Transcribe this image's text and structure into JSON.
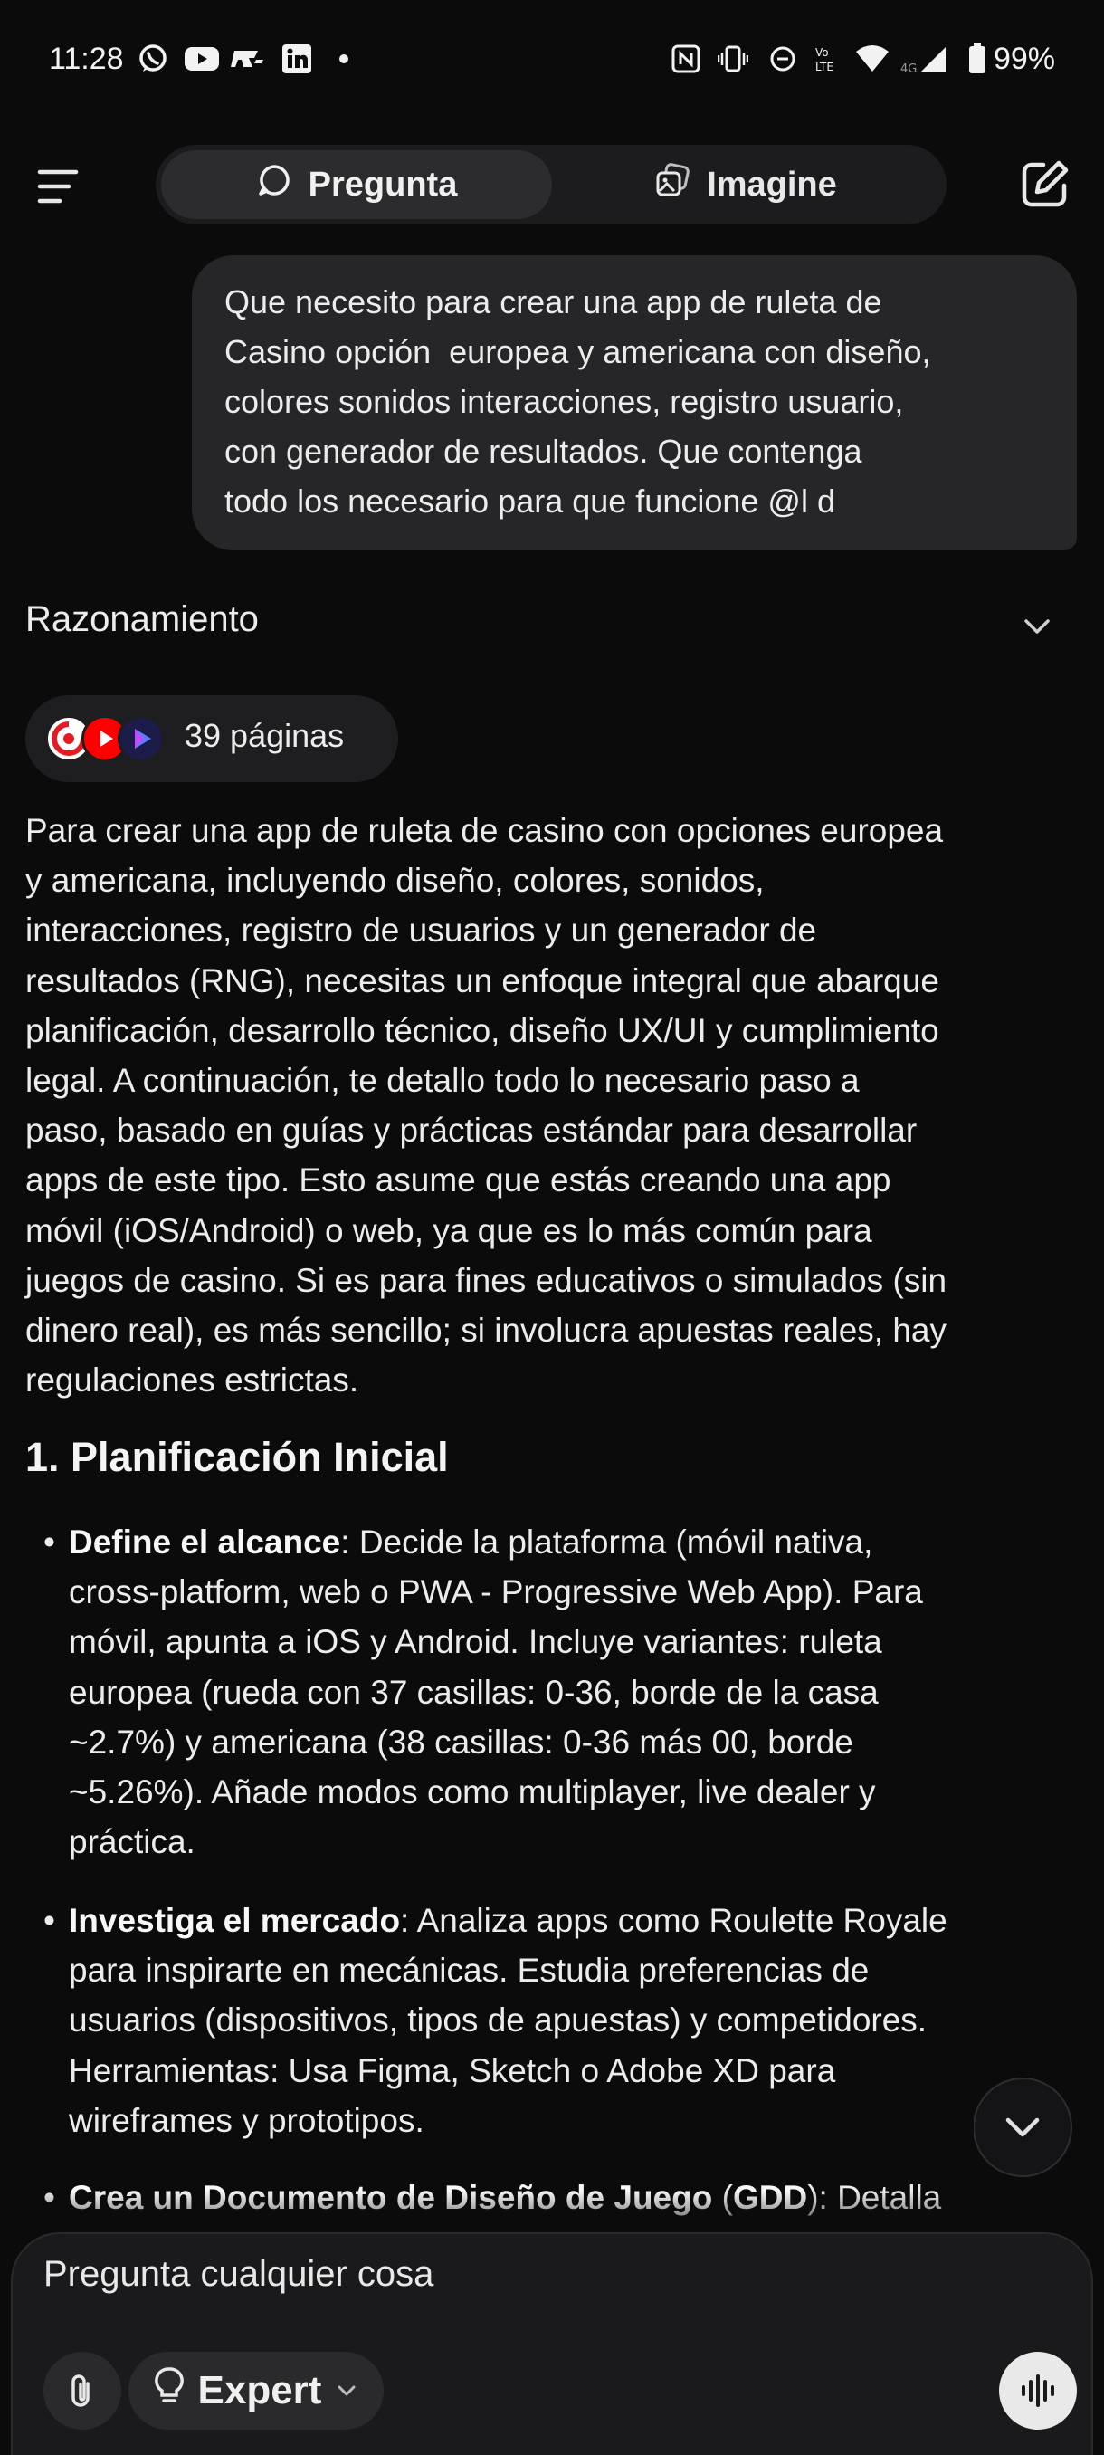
{
  "status_bar": {
    "time": "11:28",
    "battery": "99%",
    "left_icons": [
      "whatsapp-icon",
      "youtube-icon",
      "rapido-icon",
      "linkedin-icon",
      "dot-icon"
    ],
    "right_icons": [
      "nfc-icon",
      "vibrate-icon",
      "dnd-icon",
      "volte-icon",
      "wifi-icon",
      "signal-4g-icon",
      "battery-icon"
    ]
  },
  "header": {
    "tabs": [
      {
        "label": "Pregunta",
        "icon": "chat-bubble-icon",
        "active": true
      },
      {
        "label": "Imagine",
        "icon": "image-stack-icon",
        "active": false
      }
    ]
  },
  "user_message": {
    "lines": [
      "Que necesito para crear una app de ruleta de",
      "Casino opción  europea y americana con diseño,",
      "colores sonidos interacciones, registro usuario,",
      "con generador de resultados. Que contenga",
      "todo los necesario para que funcione @l d"
    ]
  },
  "reasoning": {
    "label": "Razonamiento"
  },
  "sources": {
    "label": "39 páginas",
    "icons": [
      "source-logo-red-icon",
      "youtube-source-icon",
      "source-play-icon"
    ]
  },
  "answer": {
    "intro_lines": [
      "Para crear una app de ruleta de casino con opciones europea",
      "y americana, incluyendo diseño, colores, sonidos,",
      "interacciones, registro de usuarios y un generador de",
      "resultados (RNG), necesitas un enfoque integral que abarque",
      "planificación, desarrollo técnico, diseño UX/UI y cumplimiento",
      "legal. A continuación, te detallo todo lo necesario paso a",
      "paso, basado en guías y prácticas estándar para desarrollar",
      "apps de este tipo. Esto asume que estás creando una app",
      "móvil (iOS/Android) o web, ya que es lo más común para",
      "juegos de casino. Si es para fines educativos o simulados (sin",
      "dinero real), es más sencillo; si involucra apuestas reales, hay",
      "regulaciones estrictas."
    ],
    "section_title": "1. Planificación Inicial",
    "bullets": [
      {
        "bold": "Define el alcance",
        "rest_first": ": Decide la plataforma (móvil nativa,",
        "more_lines": [
          "cross-platform, web o PWA - Progressive Web App). Para",
          "móvil, apunta a iOS y Android. Incluye variantes: ruleta",
          "europea (rueda con 37 casillas: 0-36, borde de la casa",
          "~2.7%) y americana (38 casillas: 0-36 más 00, borde",
          "~5.26%). Añade modos como multiplayer, live dealer y",
          "práctica."
        ]
      },
      {
        "bold": "Investiga el mercado",
        "rest_first": ": Analiza apps como Roulette Royale",
        "more_lines": [
          "para inspirarte en mecánicas. Estudia preferencias de",
          "usuarios (dispositivos, tipos de apuestas) y competidores.",
          "Herramientas: Usa Figma, Sketch o Adobe XD para",
          "wireframes y prototipos."
        ]
      },
      {
        "bold": "Crea un Documento de Diseño de Juego",
        "open_paren": " (",
        "bold2": "GDD",
        "rest_first": "): Detalla",
        "more_lines": []
      }
    ]
  },
  "composer": {
    "placeholder": "Pregunta cualquier cosa",
    "mode_label": "Expert"
  },
  "colors": {
    "background": "#0b0b0c",
    "bubble": "#262628",
    "pill": "#1e1e20",
    "text": "#ececec",
    "voice_button": "#e9e9e9"
  }
}
